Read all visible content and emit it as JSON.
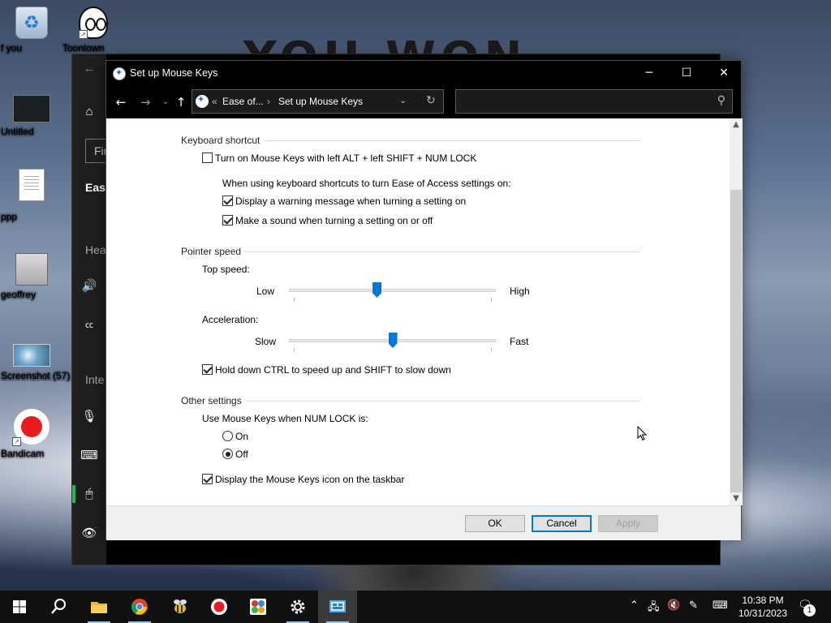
{
  "desktop": {
    "icons": [
      {
        "label": "f you"
      },
      {
        "label": "Toontown"
      },
      {
        "label": "Untitled"
      },
      {
        "label": "ppp"
      },
      {
        "label": "geoffrey"
      },
      {
        "label": "Screenshot (57)"
      },
      {
        "label": "Bandicam"
      }
    ],
    "wallpaper_text": "YOU WON"
  },
  "settings_window": {
    "find_text": "Fin",
    "section_ease": "Ease",
    "section_hearing": "Hea",
    "section_interaction": "Inte"
  },
  "dialog": {
    "title": "Set up Mouse Keys",
    "breadcrumb_parent": "Ease of...",
    "breadcrumb_current": "Set up Mouse Keys",
    "breadcrumb_prefix": "«",
    "search_placeholder": "",
    "keyboard_shortcut": {
      "title": "Keyboard shortcut",
      "turn_on": {
        "label": "Turn on Mouse Keys with left ALT + left SHIFT + NUM LOCK",
        "checked": false
      },
      "note": "When using keyboard shortcuts to turn Ease of Access settings on:",
      "warning": {
        "label": "Display a warning message when turning a setting on",
        "checked": true
      },
      "sound": {
        "label": "Make a sound when turning a setting on or off",
        "checked": true
      }
    },
    "pointer_speed": {
      "title": "Pointer speed",
      "top_speed_label": "Top speed:",
      "top_low": "Low",
      "top_high": "High",
      "top_speed_value": 0.42,
      "acceleration_label": "Acceleration:",
      "acc_slow": "Slow",
      "acc_fast": "Fast",
      "acceleration_value": 0.5,
      "ctrl_shift": {
        "label": "Hold down CTRL to speed up and SHIFT to slow down",
        "checked": true
      }
    },
    "other_settings": {
      "title": "Other settings",
      "numlock_label": "Use Mouse Keys when NUM LOCK is:",
      "on_label": "On",
      "off_label": "Off",
      "selected": "Off",
      "taskbar_icon": {
        "label": "Display the Mouse Keys icon on the taskbar",
        "checked": true
      }
    },
    "buttons": {
      "ok": "OK",
      "cancel": "Cancel",
      "apply": "Apply"
    }
  },
  "taskbar": {
    "time": "10:38 PM",
    "date": "10/31/2023",
    "notification_count": "1"
  },
  "colors": {
    "accent": "#0078d7",
    "titlebar": "#000000"
  }
}
